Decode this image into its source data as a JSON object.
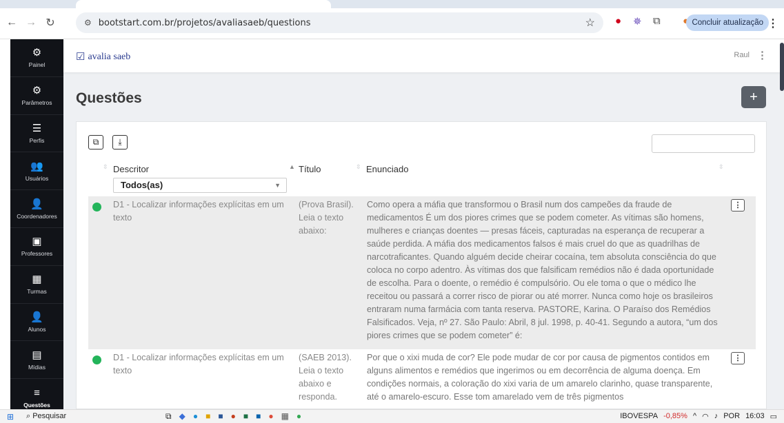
{
  "browser": {
    "url": "bootstart.com.br/projetos/avaliasaeb/questions",
    "update_button": "Concluir atualização"
  },
  "sidebar": {
    "items": [
      {
        "label": "Painel",
        "icon": "dashboard-icon",
        "glyph": "⚙"
      },
      {
        "label": "Parâmetros",
        "icon": "gears-icon",
        "glyph": "⚙"
      },
      {
        "label": "Perfis",
        "icon": "list-check-icon",
        "glyph": "☰"
      },
      {
        "label": "Usuários",
        "icon": "users-icon",
        "glyph": "👥"
      },
      {
        "label": "Coordenadores",
        "icon": "user-tie-icon",
        "glyph": "👤"
      },
      {
        "label": "Professores",
        "icon": "chalkboard-icon",
        "glyph": "▣"
      },
      {
        "label": "Turmas",
        "icon": "class-icon",
        "glyph": "▦"
      },
      {
        "label": "Alunos",
        "icon": "student-icon",
        "glyph": "👤"
      },
      {
        "label": "Mídias",
        "icon": "media-icon",
        "glyph": "▤"
      },
      {
        "label": "Questões",
        "icon": "questions-icon",
        "glyph": "≡"
      }
    ]
  },
  "topbar": {
    "brand": "avalia saeb",
    "user": "Raul"
  },
  "page": {
    "title": "Questões"
  },
  "table": {
    "headers": {
      "descritor": "Descritor",
      "titulo": "Título",
      "enunciado": "Enunciado"
    },
    "filter_value": "Todos(as)",
    "rows": [
      {
        "descritor": "D1 - Localizar informações explícitas em um texto",
        "titulo": "(Prova Brasil). Leia o texto abaixo:",
        "enunciado": "Como opera a máfia que transformou o Brasil num dos campeões da fraude de medicamentos É um dos piores crimes que se podem cometer. As vítimas são homens, mulheres e crianças doentes — presas fáceis, capturadas na esperança de recuperar a saúde perdida. A máfia dos medicamentos falsos é mais cruel do que as quadrilhas de narcotraficantes. Quando alguém decide cheirar cocaína, tem absoluta consciência do que coloca no corpo adentro. Às vítimas dos que falsificam remédios não é dada oportunidade de escolha. Para o doente, o remédio é compulsório. Ou ele toma o que o médico lhe receitou ou passará a correr risco de piorar ou até morrer. Nunca como hoje os brasileiros entraram numa farmácia com tanta reserva. PASTORE, Karina. O Paraíso dos Remédios Falsificados. Veja, nº 27. São Paulo: Abril, 8 jul. 1998, p. 40-41. Segundo a autora, “um dos piores crimes que se podem cometer” é:"
      },
      {
        "descritor": "D1 - Localizar informações explícitas em um texto",
        "titulo": "(SAEB 2013). Leia o texto abaixo e responda.",
        "enunciado": "Por que o xixi muda de cor? Ele pode mudar de cor por causa de pigmentos contidos em alguns alimentos e remédios que ingerimos ou em decorrência de alguma doença. Em condições normais, a coloração do xixi varia de um amarelo clarinho, quase transparente, até o amarelo-escuro. Esse tom amarelado vem de três pigmentos"
      }
    ]
  },
  "taskbar": {
    "search_label": "Pesquisar",
    "ticker": "IBOVESPA",
    "ticker_change": "-0,85%",
    "lang": "POR",
    "time": "16:03"
  },
  "colors": {
    "sidebar_bg": "#111318",
    "status_active": "#23b45a",
    "brand": "#2a3b8f"
  }
}
